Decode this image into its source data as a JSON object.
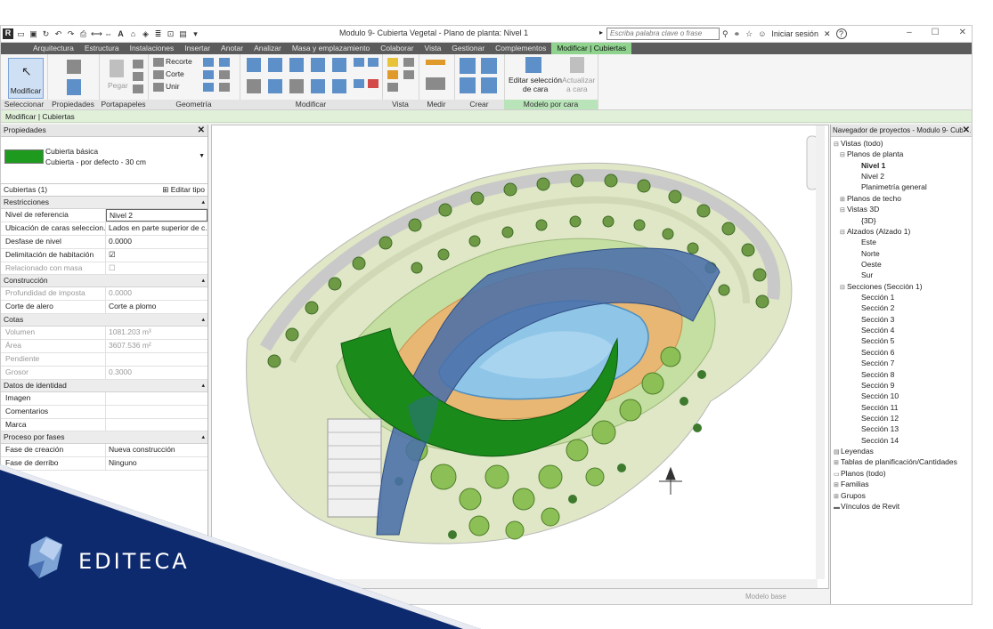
{
  "titlebar": {
    "title": "Modulo 9- Cubierta  Vegetal - Plano de planta: Nivel 1",
    "search_placeholder": "Escriba palabra clave o frase",
    "signin": "Iniciar sesión",
    "help": "?",
    "app_icon": "R"
  },
  "tabs": [
    "Arquitectura",
    "Estructura",
    "Instalaciones",
    "Insertar",
    "Anotar",
    "Analizar",
    "Masa y emplazamiento",
    "Colaborar",
    "Vista",
    "Gestionar",
    "Complementos",
    "Modificar | Cubiertas"
  ],
  "ribbon": {
    "modify_label": "Modificar",
    "paste_label": "Pegar",
    "recorte": "Recorte",
    "corte": "Corte",
    "unir": "Unir",
    "edit_face_line1": "Editar selección",
    "edit_face_line2": "de cara",
    "update_face_line1": "Actualizar",
    "update_face_line2": "a cara",
    "panels": [
      "Seleccionar",
      "Propiedades",
      "Portapapeles",
      "Geometría",
      "Modificar",
      "Vista",
      "Medir",
      "Crear",
      "Modelo por cara"
    ]
  },
  "context_bar": "Modificar | Cubiertas",
  "properties": {
    "title": "Propiedades",
    "type_name": "Cubierta básica",
    "type_variant": "Cubierta - por defecto - 30 cm",
    "instance": "Cubiertas (1)",
    "edit_type": "Editar tipo",
    "groups": [
      {
        "name": "Restricciones",
        "rows": [
          {
            "k": "Nivel de referencia",
            "v": "Nivel 2"
          },
          {
            "k": "Ubicación de caras seleccion...",
            "v": "Lados en parte superior de c..."
          },
          {
            "k": "Desfase de nivel",
            "v": "0.0000"
          },
          {
            "k": "Delimitación de habitación",
            "v": "☑"
          },
          {
            "k": "Relacionado con masa",
            "v": "☐"
          }
        ]
      },
      {
        "name": "Construcción",
        "rows": [
          {
            "k": "Profundidad de imposta",
            "v": "0.0000"
          },
          {
            "k": "Corte de alero",
            "v": "Corte a plomo"
          }
        ]
      },
      {
        "name": "Cotas",
        "rows": [
          {
            "k": "Volumen",
            "v": "1081.203 m³"
          },
          {
            "k": "Área",
            "v": "3607.536 m²"
          },
          {
            "k": "Pendiente",
            "v": ""
          },
          {
            "k": "Grosor",
            "v": "0.3000"
          }
        ]
      },
      {
        "name": "Datos de identidad",
        "rows": [
          {
            "k": "Imagen",
            "v": ""
          },
          {
            "k": "Comentarios",
            "v": ""
          },
          {
            "k": "Marca",
            "v": ""
          }
        ]
      },
      {
        "name": "Proceso por fases",
        "rows": [
          {
            "k": "Fase de creación",
            "v": "Nueva construcción"
          },
          {
            "k": "Fase de derribo",
            "v": "Ninguno"
          }
        ]
      }
    ]
  },
  "browser": {
    "title": "Navegador de proyectos - Modulo 9- Cubi...",
    "items": [
      {
        "t": "Vistas (todo)",
        "l": 0,
        "e": "⊟"
      },
      {
        "t": "Planos de planta",
        "l": 1,
        "e": "⊟"
      },
      {
        "t": "Nivel 1",
        "l": 2,
        "e": "",
        "b": true
      },
      {
        "t": "Nivel 2",
        "l": 2,
        "e": ""
      },
      {
        "t": "Planimetría general",
        "l": 2,
        "e": ""
      },
      {
        "t": "Planos de techo",
        "l": 1,
        "e": "⊞"
      },
      {
        "t": "Vistas 3D",
        "l": 1,
        "e": "⊟"
      },
      {
        "t": "{3D}",
        "l": 2,
        "e": ""
      },
      {
        "t": "Alzados (Alzado 1)",
        "l": 1,
        "e": "⊟"
      },
      {
        "t": "Este",
        "l": 2,
        "e": ""
      },
      {
        "t": "Norte",
        "l": 2,
        "e": ""
      },
      {
        "t": "Oeste",
        "l": 2,
        "e": ""
      },
      {
        "t": "Sur",
        "l": 2,
        "e": ""
      },
      {
        "t": "Secciones (Sección 1)",
        "l": 1,
        "e": "⊟"
      },
      {
        "t": "Sección 1",
        "l": 2,
        "e": ""
      },
      {
        "t": "Sección 2",
        "l": 2,
        "e": ""
      },
      {
        "t": "Sección 3",
        "l": 2,
        "e": ""
      },
      {
        "t": "Sección 4",
        "l": 2,
        "e": ""
      },
      {
        "t": "Sección 5",
        "l": 2,
        "e": ""
      },
      {
        "t": "Sección 6",
        "l": 2,
        "e": ""
      },
      {
        "t": "Sección 7",
        "l": 2,
        "e": ""
      },
      {
        "t": "Sección 8",
        "l": 2,
        "e": ""
      },
      {
        "t": "Sección 9",
        "l": 2,
        "e": ""
      },
      {
        "t": "Sección 10",
        "l": 2,
        "e": ""
      },
      {
        "t": "Sección 11",
        "l": 2,
        "e": ""
      },
      {
        "t": "Sección 12",
        "l": 2,
        "e": ""
      },
      {
        "t": "Sección 13",
        "l": 2,
        "e": ""
      },
      {
        "t": "Sección 14",
        "l": 2,
        "e": ""
      },
      {
        "t": "Leyendas",
        "l": 0,
        "e": "▤"
      },
      {
        "t": "Tablas de planificación/Cantidades",
        "l": 0,
        "e": "⊞"
      },
      {
        "t": "Planos (todo)",
        "l": 0,
        "e": "▭"
      },
      {
        "t": "Familias",
        "l": 0,
        "e": "⊞"
      },
      {
        "t": "Grupos",
        "l": 0,
        "e": "⊞"
      },
      {
        "t": "Vínculos de Revit",
        "l": 0,
        "e": "▬"
      }
    ]
  },
  "statusbar": {
    "model": "Modelo base"
  },
  "brand": {
    "name": "EDITECA",
    "band_color": "#0d2a6e",
    "roof_green": "#1a8a1a",
    "roof_blue": "#4a6fa8"
  }
}
